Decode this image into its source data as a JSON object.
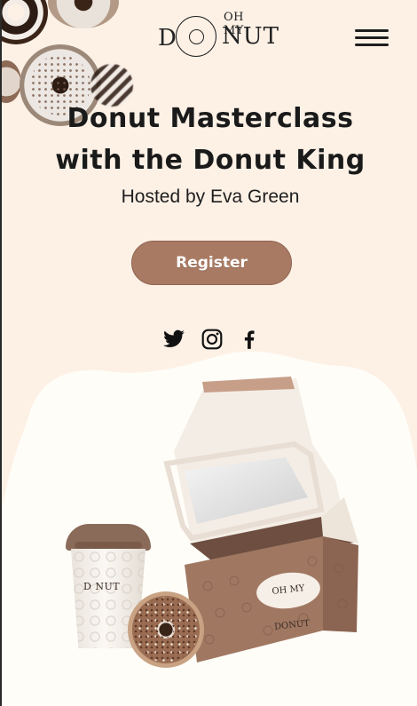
{
  "header": {
    "logo": {
      "top": "OH MY",
      "left": "D",
      "right": "NUT"
    },
    "menu_icon": "hamburger-menu-icon"
  },
  "hero": {
    "title_line1": "Donut Masterclass",
    "title_line2": "with the Donut King",
    "host": "Hosted by Eva Green",
    "register_label": "Register"
  },
  "social": [
    {
      "name": "twitter",
      "icon": "twitter-icon"
    },
    {
      "name": "instagram",
      "icon": "instagram-icon"
    },
    {
      "name": "facebook",
      "icon": "facebook-icon"
    }
  ],
  "product": {
    "cup_logo": "D  NUT",
    "box_logo": "OH MY DONUT"
  },
  "colors": {
    "background": "#fdf1e6",
    "accent": "#a97a63",
    "text": "#1a1a1a",
    "cream": "#fffdf8"
  }
}
